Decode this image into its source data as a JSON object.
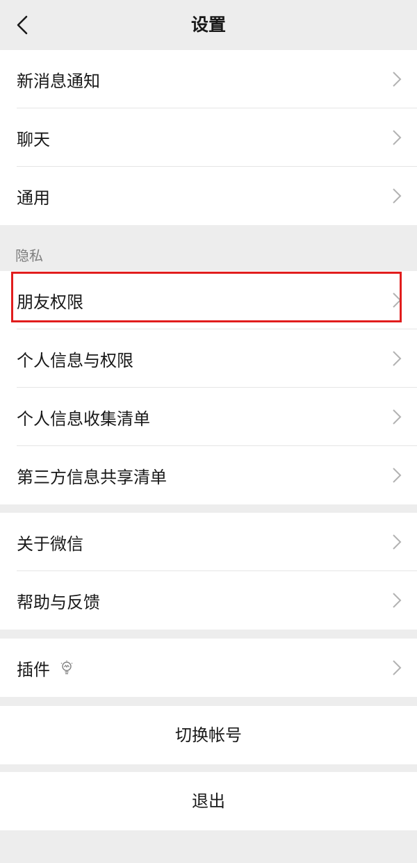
{
  "nav": {
    "title": "设置",
    "back_icon": "chevron-left-icon"
  },
  "group1": {
    "items": [
      {
        "label": "新消息通知"
      },
      {
        "label": "聊天"
      },
      {
        "label": "通用"
      }
    ]
  },
  "privacy": {
    "header": "隐私",
    "items": [
      {
        "label": "朋友权限",
        "highlighted": true
      },
      {
        "label": "个人信息与权限"
      },
      {
        "label": "个人信息收集清单"
      },
      {
        "label": "第三方信息共享清单"
      }
    ]
  },
  "group3": {
    "items": [
      {
        "label": "关于微信"
      },
      {
        "label": "帮助与反馈"
      }
    ]
  },
  "group4": {
    "items": [
      {
        "label": "插件",
        "icon": "lightbulb-icon"
      }
    ]
  },
  "actions": {
    "switch_account": "切换帐号",
    "logout": "退出"
  },
  "colors": {
    "background": "#ededed",
    "card": "#ffffff",
    "highlight": "#e11d1d",
    "text": "#191919",
    "secondary_text": "#7f7f7f"
  }
}
